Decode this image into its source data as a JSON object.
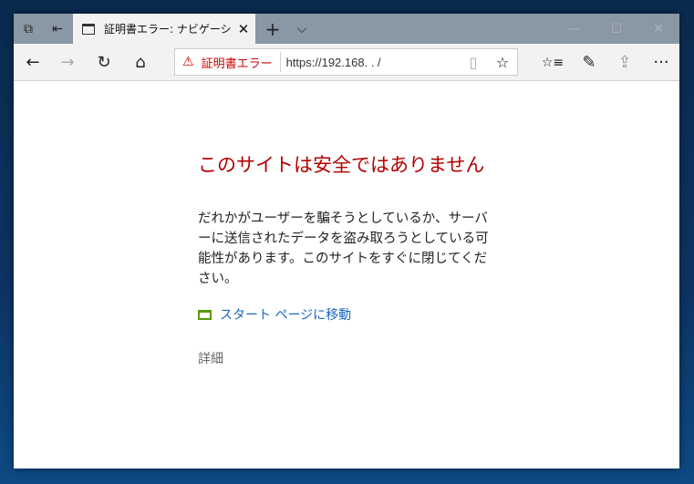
{
  "tab": {
    "title": "証明書エラー: ナビゲーション",
    "close": "✕",
    "new_tab": "+",
    "tab_list": "⌵"
  },
  "window": {
    "minimize": "—",
    "maximize": "☐",
    "close": "✕"
  },
  "nav": {
    "back": "←",
    "forward": "→",
    "refresh": "↻",
    "home": "⌂",
    "favorites": "☆≡",
    "notes": "✎",
    "share": "⇪",
    "more": "···"
  },
  "address": {
    "warning_icon": "⚠",
    "warning_label": "証明書エラー",
    "url": "https://192.168.    .      /",
    "reading_view": "▯",
    "favorite": "☆"
  },
  "page": {
    "heading": "このサイトは安全ではありません",
    "body_lines": [
      "だれかがユーザーを騙そうとしているか、サーバ",
      "ーに送信されたデータを盗み取ろうとしている可",
      "能性があります。このサイトをすぐに閉じてくだ",
      "さい。"
    ],
    "start_link": "スタート ページに移動",
    "details": "詳細"
  },
  "colors": {
    "heading": "#b30000",
    "link": "#1a66c6",
    "warning": "#cc0000"
  }
}
